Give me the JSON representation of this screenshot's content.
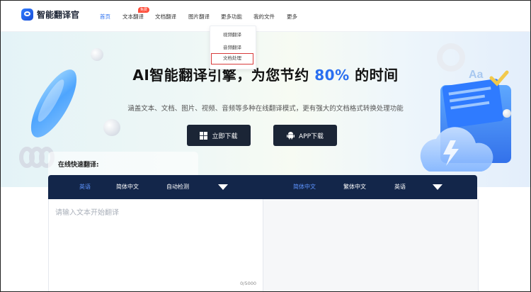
{
  "brand": {
    "name": "智能翻译官"
  },
  "nav": [
    {
      "label": "首页",
      "active": true
    },
    {
      "label": "文本翻译",
      "badge": "免费"
    },
    {
      "label": "文档翻译"
    },
    {
      "label": "图片翻译"
    },
    {
      "label": "更多功能"
    },
    {
      "label": "我的文件"
    },
    {
      "label": "更多"
    }
  ],
  "dropdown": {
    "items": [
      "视频翻译",
      "音频翻译",
      "文档处理"
    ],
    "selected": "文档处理"
  },
  "hero": {
    "title_prefix": "AI智能翻译引擎，为您节约",
    "title_pct": "80%",
    "title_suffix": "的时间",
    "subtitle": "涵盖文本、文档、图片、视频、音频等多种在线翻译模式，更有强大的文档格式转换处理功能",
    "buttons": {
      "download": "立即下载",
      "app": "APP下载"
    }
  },
  "translator": {
    "label": "在线快速翻译:",
    "source_langs": [
      "英语",
      "简体中文",
      "自动检测"
    ],
    "source_active": "英语",
    "target_langs": [
      "简体中文",
      "繁体中文",
      "英语"
    ],
    "target_active": "简体中文",
    "placeholder": "请输入文本开始翻译",
    "counter": "0/5000"
  },
  "colors": {
    "accent": "#2a6ff0",
    "dark_bar": "#13264a",
    "button_dark": "#1b2536",
    "badge": "#ff4d3a",
    "highlight": "#d83a3a"
  }
}
